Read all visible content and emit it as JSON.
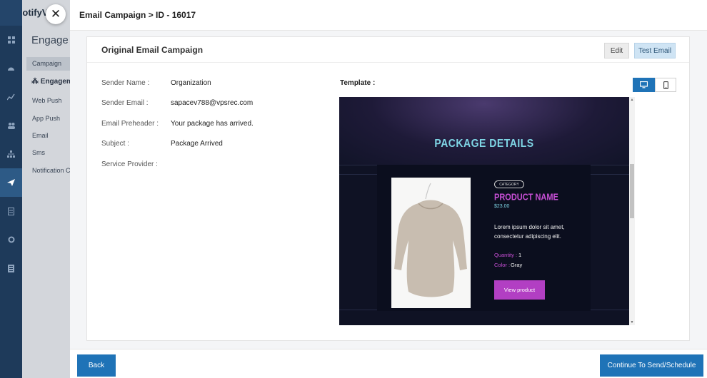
{
  "app": {
    "brand": "NotifyV"
  },
  "sidebar": {
    "heading": "Engage",
    "active_item": "Campaign",
    "group": "Engagem",
    "items": [
      "Web Push",
      "App Push",
      "Email",
      "Sms",
      "Notification C"
    ]
  },
  "modal": {
    "title": "Email Campaign > ID - 16017",
    "close": "✕"
  },
  "card": {
    "title": "Original Email Campaign",
    "edit_label": "Edit",
    "test_label": "Test Email"
  },
  "fields": [
    {
      "label": "Sender Name :",
      "value": "Organization"
    },
    {
      "label": "Sender Email :",
      "value": "sapacev788@vpsrec.com"
    },
    {
      "label": "Email Preheader :",
      "value": "Your package has arrived."
    },
    {
      "label": "Subject :",
      "value": "Package Arrived"
    },
    {
      "label": "Service Provider :",
      "value": ""
    }
  ],
  "template": {
    "label": "Template :",
    "view_modes": [
      "desktop-icon",
      "mobile-icon"
    ],
    "preview": {
      "heading": "PACKAGE DETAILS",
      "badge": "CATEGORY",
      "product_name": "PRODUCT NAME",
      "price": "$23.00",
      "description": "Lorem ipsum dolor sit amet, consectetur adipiscing elit.",
      "quantity_label": "Quantity :",
      "quantity_value": "1",
      "color_label": "Color :",
      "color_value": "Gray",
      "button_label": "View product"
    }
  },
  "footer": {
    "back_label": "Back",
    "continue_label": "Continue To Send/Schedule"
  },
  "colors": {
    "primary": "#1f73b7",
    "rail": "#1e3a5a",
    "accent_magenta": "#c84fd6",
    "accent_cyan": "#7fd6e6"
  }
}
